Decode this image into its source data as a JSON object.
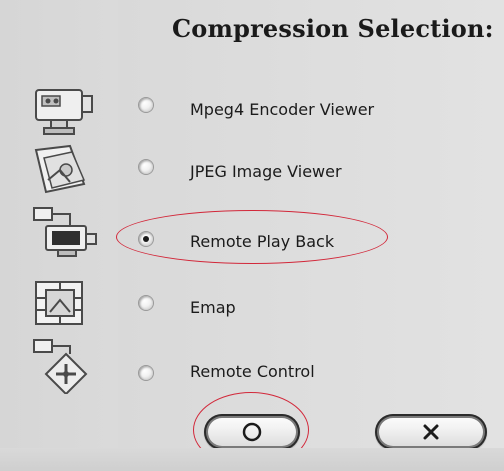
{
  "dialog": {
    "title": "Compression Selection:"
  },
  "options": [
    {
      "label": "Mpeg4 Encoder Viewer",
      "selected": false,
      "icon": "camera-icon"
    },
    {
      "label": "JPEG Image Viewer",
      "selected": false,
      "icon": "image-icon"
    },
    {
      "label": "Remote Play Back",
      "selected": true,
      "icon": "monitor-playback-icon"
    },
    {
      "label": "Emap",
      "selected": false,
      "icon": "map-icon"
    },
    {
      "label": "Remote Control",
      "selected": false,
      "icon": "remote-control-icon"
    }
  ],
  "buttons": {
    "ok_icon": "circle-icon",
    "cancel_icon": "x-icon"
  },
  "annotations": {
    "color": "#d2283a"
  }
}
